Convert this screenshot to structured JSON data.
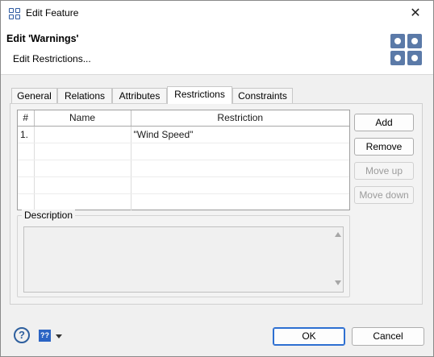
{
  "window": {
    "title": "Edit Feature",
    "close_glyph": "✕",
    "icon": "grid-icon"
  },
  "header": {
    "title": "Edit 'Warnings'",
    "subtitle": "Edit Restrictions...",
    "icon": "feature-grid-icon"
  },
  "tabs": [
    {
      "label": "General",
      "active": false
    },
    {
      "label": "Relations",
      "active": false
    },
    {
      "label": "Attributes",
      "active": false
    },
    {
      "label": "Restrictions",
      "active": true
    },
    {
      "label": "Constraints",
      "active": false
    }
  ],
  "table": {
    "columns": [
      "#",
      "Name",
      "Restriction"
    ],
    "rows": [
      [
        "1.",
        "",
        "\"Wind Speed\""
      ],
      [
        "",
        "",
        ""
      ],
      [
        "",
        "",
        ""
      ],
      [
        "",
        "",
        ""
      ],
      [
        "",
        "",
        ""
      ]
    ]
  },
  "side_buttons": {
    "add": "Add",
    "remove": "Remove",
    "move_up": "Move up",
    "move_down": "Move down"
  },
  "description": {
    "label": "Description",
    "value": ""
  },
  "footer": {
    "help_glyph": "?",
    "context_help_glyph": "??",
    "ok": "OK",
    "cancel": "Cancel"
  },
  "colors": {
    "accent": "#2d6fd1",
    "icon_blue": "#5b7aa8"
  }
}
